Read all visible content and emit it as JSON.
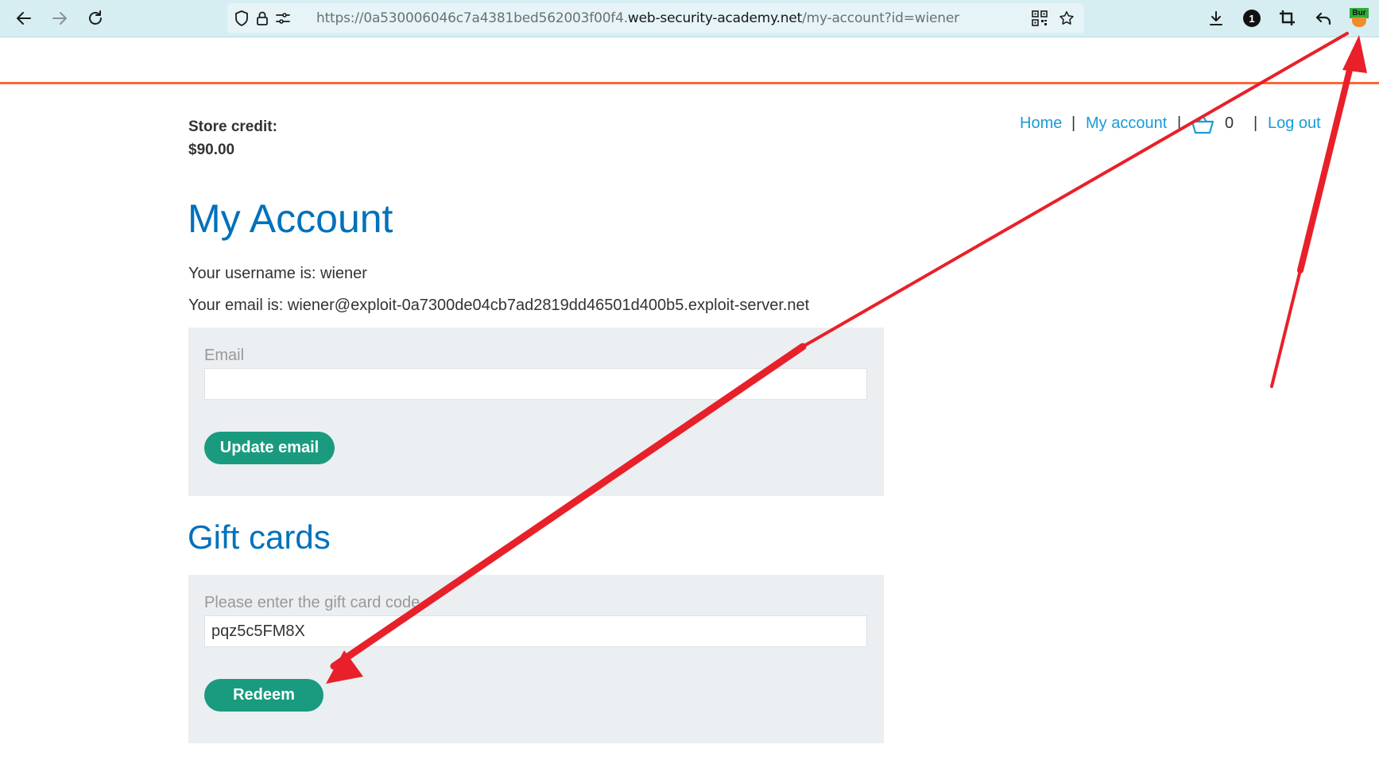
{
  "browser": {
    "url_prefix": "https://0a530006046c7a4381bed562003f00f4.",
    "url_host": "web-security-academy.net",
    "url_path": "/my-account?id=wiener",
    "badge_count": "1",
    "burp_label": "Bur",
    "icons": [
      "back-arrow-icon",
      "forward-arrow-icon",
      "reload-icon",
      "shield-icon",
      "lock-icon",
      "permissions-icon",
      "qr-code-icon",
      "bookmark-star-icon",
      "download-icon",
      "crop-icon",
      "undo-arrow-icon",
      "burp-extension-icon"
    ]
  },
  "header": {
    "store_credit_label": "Store credit:",
    "store_credit_value": "$90.00",
    "nav": {
      "home": "Home",
      "my_account": "My account",
      "cart_count": "0",
      "logout": "Log out",
      "separator": "|"
    }
  },
  "account": {
    "title": "My Account",
    "username_line": "Your username is: wiener",
    "email_line": "Your email is: wiener@exploit-0a7300de04cb7ad2819dd46501d400b5.exploit-server.net",
    "email_form": {
      "label": "Email",
      "value": "",
      "button": "Update email"
    }
  },
  "gift_cards": {
    "title": "Gift cards",
    "label": "Please enter the gift card code",
    "value": "pqz5c5FM8X",
    "button": "Redeem"
  },
  "colors": {
    "accent_blue": "#0071bc",
    "link_blue": "#1a9bd7",
    "button_green": "#1a9b7f",
    "header_rule_orange": "#ff6633",
    "annotation_red": "#e8202a"
  }
}
